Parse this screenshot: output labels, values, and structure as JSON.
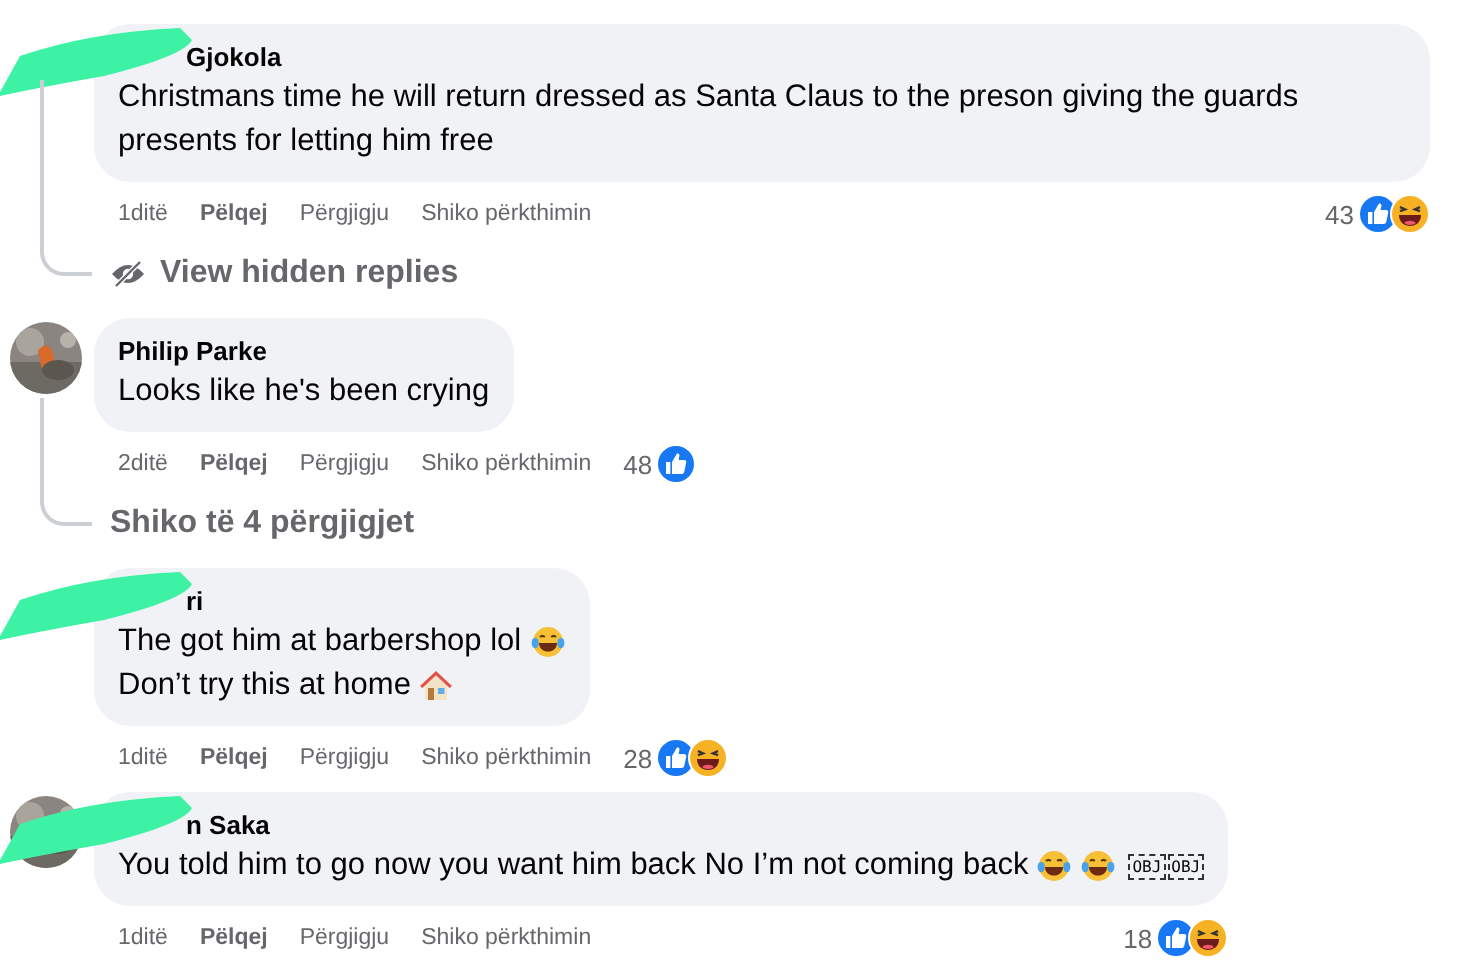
{
  "thread": [
    {
      "kind": "comment",
      "redacted": true,
      "author": "Gjokola",
      "lines": [
        {
          "text": "Christmans time he will return dressed as Santa Claus to the preson giving the guards presents for letting him free"
        }
      ],
      "time": "1ditë",
      "like": "Pëlqej",
      "reply": "Përgjigju",
      "translate": "Shiko përkthimin",
      "count": "43",
      "reactions": [
        {
          "kind": "like"
        },
        {
          "kind": "haha"
        }
      ]
    },
    {
      "kind": "replies_link",
      "label": "View hidden replies",
      "hidden_replies": true
    },
    {
      "kind": "comment",
      "redacted": false,
      "avatar": {
        "kind": "picture"
      },
      "author": "Philip Parke",
      "lines": [
        {
          "text": "Looks like he's been crying"
        }
      ],
      "time": "2ditë",
      "like": "Pëlqej",
      "reply": "Përgjigju",
      "translate": "Shiko përkthimin",
      "count": "48",
      "reactions": [
        {
          "kind": "like"
        }
      ]
    },
    {
      "kind": "replies_link",
      "label": "Shiko të 4 përgjigjet",
      "hidden_replies": false
    },
    {
      "kind": "comment",
      "redacted": true,
      "author": "ri",
      "lines": [
        {
          "text": "The got him at barbershop lol",
          "icons": [
            {
              "kind": "laugh"
            }
          ]
        },
        {
          "text": "Don’t try this at home",
          "icons": [
            {
              "kind": "house"
            }
          ]
        }
      ],
      "time": "1ditë",
      "like": "Pëlqej",
      "reply": "Përgjigju",
      "translate": "Shiko përkthimin",
      "count": "28",
      "reactions": [
        {
          "kind": "like"
        },
        {
          "kind": "haha"
        }
      ]
    },
    {
      "kind": "comment",
      "redacted": true,
      "avatar": {
        "kind": "picture"
      },
      "author": "n Saka",
      "lines": [
        {
          "text": "You told him to go now you want him back No I’m not coming back",
          "icons": [
            {
              "kind": "laugh"
            },
            {
              "kind": "laugh"
            }
          ],
          "obj_marks": [
            "OBJ",
            "OBJ"
          ]
        }
      ],
      "time": "1ditë",
      "like": "Pëlqej",
      "reply": "Përgjigju",
      "translate": "Shiko përkthimin",
      "count": "18",
      "reactions": [
        {
          "kind": "like"
        },
        {
          "kind": "haha"
        }
      ]
    }
  ]
}
